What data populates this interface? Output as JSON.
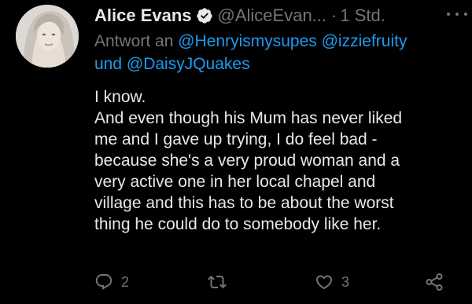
{
  "tweet": {
    "author": {
      "display_name": "Alice Evans",
      "handle": "@AliceEvan...",
      "verified_icon": "verified-badge-icon",
      "avatar_icon": "avatar"
    },
    "separator": "·",
    "time": "1 Std.",
    "more_icon": "more-options-icon",
    "reply_prefix": "Antwort an",
    "mentions": [
      "@Henryismysupes",
      "@izziefruity",
      "@DaisyJQuakes"
    ],
    "reply_joiner": "und",
    "text_lines": [
      "I know.",
      "And even though his Mum has never liked",
      "me and I gave up trying, I do feel bad -",
      "because she's a very proud woman and a",
      "very active one in her local chapel and",
      "village and this has to be about the worst",
      "thing he could do to somebody like her."
    ],
    "actions": {
      "reply_count": "2",
      "retweet_count": "",
      "like_count": "3"
    },
    "colors": {
      "background": "#000000",
      "text": "#e7e9ea",
      "muted": "#71767b",
      "link": "#1d9bf0",
      "verified": "#1d9bf0"
    }
  }
}
